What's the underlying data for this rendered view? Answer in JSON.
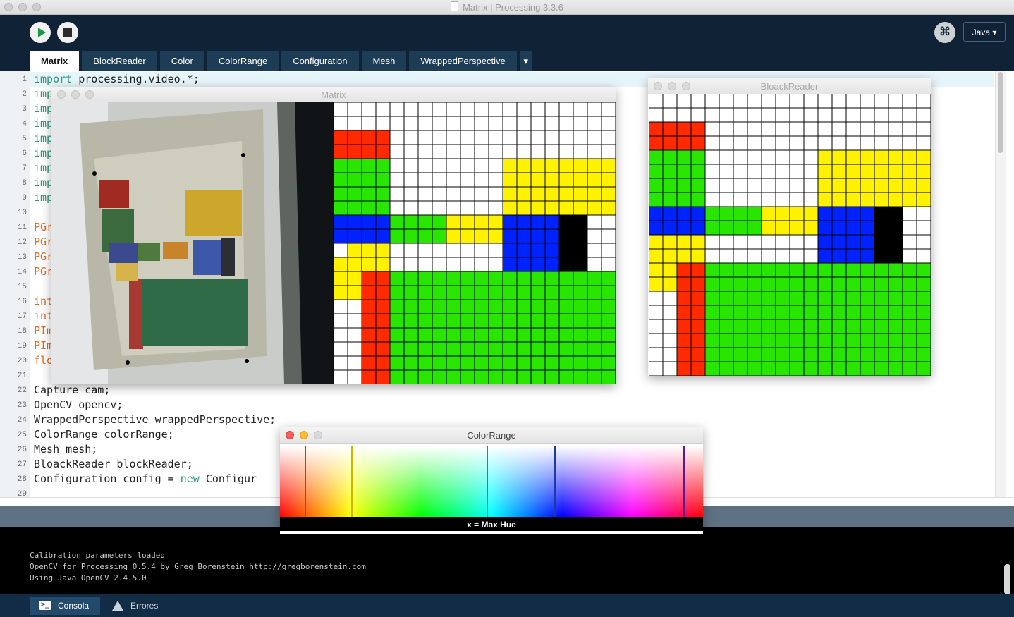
{
  "window": {
    "title": "Matrix | Processing 3.3.6"
  },
  "toolbar": {
    "run": "run-icon",
    "stop": "stop-icon",
    "mode_icon": "⌘",
    "mode_label": "Java ▾"
  },
  "tabs": [
    "Matrix",
    "BlockReader",
    "Color",
    "ColorRange",
    "Configuration",
    "Mesh",
    "WrappedPerspective",
    "▾"
  ],
  "editor": {
    "line_numbers": [
      "1",
      "2",
      "3",
      "4",
      "5",
      "6",
      "7",
      "8",
      "9",
      "10",
      "11",
      "12",
      "13",
      "14",
      "15",
      "16",
      "17",
      "18",
      "19",
      "20",
      "21",
      "22",
      "23",
      "24",
      "25",
      "26",
      "27",
      "28",
      "29"
    ],
    "lines": [
      {
        "kw": "import",
        "rest": " processing.video.*;",
        "color": "kw"
      },
      {
        "kw": "imp",
        "rest": "",
        "color": "kw"
      },
      {
        "kw": "imp",
        "rest": "",
        "color": "kw"
      },
      {
        "kw": "imp",
        "rest": "",
        "color": "kw"
      },
      {
        "kw": "imp",
        "rest": "",
        "color": "kw"
      },
      {
        "kw": "imp",
        "rest": "",
        "color": "kw"
      },
      {
        "kw": "imp",
        "rest": "",
        "color": "kw"
      },
      {
        "kw": "imp",
        "rest": "",
        "color": "kw"
      },
      {
        "kw": "imp",
        "rest": "",
        "color": "kw"
      },
      {
        "kw": "",
        "rest": "",
        "color": "kw"
      },
      {
        "kw": "PGr",
        "rest": "",
        "color": "typ"
      },
      {
        "kw": "PGr",
        "rest": "",
        "color": "typ"
      },
      {
        "kw": "PGr",
        "rest": "",
        "color": "typ"
      },
      {
        "kw": "PGr",
        "rest": "",
        "color": "typ"
      },
      {
        "kw": "",
        "rest": "",
        "color": "kw"
      },
      {
        "kw": "int",
        "rest": "",
        "color": "typ"
      },
      {
        "kw": "int",
        "rest": "",
        "color": "typ"
      },
      {
        "kw": "PIm",
        "rest": "",
        "color": "typ"
      },
      {
        "kw": "PIm",
        "rest": "",
        "color": "typ"
      },
      {
        "kw": "flo",
        "rest": "",
        "color": "typ"
      },
      {
        "kw": "",
        "rest": "",
        "color": "kw"
      },
      {
        "kw": "",
        "rest": "Capture cam;",
        "color": "kw"
      },
      {
        "kw": "",
        "rest": "OpenCV opencv;",
        "color": "kw"
      },
      {
        "kw": "",
        "rest": "WrappedPerspective wrappedPerspective;",
        "color": "kw"
      },
      {
        "kw": "",
        "rest": "ColorRange colorRange;",
        "color": "kw"
      },
      {
        "kw": "",
        "rest": "Mesh mesh;",
        "color": "kw"
      },
      {
        "kw": "",
        "rest": "BloackReader blockReader;",
        "color": "kw"
      },
      {
        "kw": "",
        "rest": "Configuration config = ",
        "color": "kw",
        "tail_kw": "new",
        "tail": " Configur"
      },
      {
        "kw": "",
        "rest": "",
        "color": "kw"
      }
    ]
  },
  "console": {
    "lines": [
      "Calibration parameters loaded",
      "OpenCV for Processing 0.5.4 by Greg Borenstein http://gregborenstein.com",
      "Using Java OpenCV 2.4.5.0"
    ]
  },
  "bottom_tabs": {
    "console": "Consola",
    "errors": "Errores"
  },
  "matrix_window": {
    "title": "Matrix",
    "grid": {
      "rows": 20,
      "cols": 20,
      "cells": [
        "WWWWWWWWWWWWWWWWWWWW",
        "WWWWWWWWWWWWWWWWWWWW",
        "RRRRWWWWWWWWWWWWWWWW",
        "RRRRWWWWWWWWWWWWWWWW",
        "GGGGWWWWWWWWYYYYYYYY",
        "GGGGWWWWWWWWYYYYYYYY",
        "GGGGWWWWWWWWYYYYYYYY",
        "GGGGWWWWWWWWYYYYYYYY",
        "BBBBGGGGYYYYBBBBKKWW",
        "BBBBGGGGYYYYBBBBKKWW",
        "WYYYWWWWWWWWBBBBKKWW",
        "YYYYWWWWWWWWBBBBKKWW",
        "YYRRGGGGGGGGGGGGGGGG",
        "YYRRGGGGGGGGGGGGGGGG",
        "WWRRGGGGGGGGGGGGGGGG",
        "WWRRGGGGGGGGGGGGGGGG",
        "WWRRGGGGGGGGGGGGGGGG",
        "WWRRGGGGGGGGGGGGGGGG",
        "WWRRGGGGGGGGGGGGGGGG",
        "WWRRGGGGGGGGGGGGGGGG"
      ]
    }
  },
  "block_window": {
    "title": "BloackReader",
    "grid": {
      "rows": 20,
      "cols": 20,
      "cells": [
        "WWWWWWWWWWWWWWWWWWWW",
        "WWWWWWWWWWWWWWWWWWWW",
        "RRRRWWWWWWWWWWWWWWWW",
        "RRRRWWWWWWWWWWWWWWWW",
        "GGGGWWWWWWWWYYYYYYYY",
        "GGGGWWWWWWWWYYYYYYYY",
        "GGGGWWWWWWWWYYYYYYYY",
        "GGGGWWWWWWWWYYYYYYYY",
        "BBBBGGGGYYYYBBBBKKWW",
        "BBBBGGGGYYYYBBBBKKWW",
        "YYYYWWWWWWWWBBBBKKWW",
        "YYYYWWWWWWWWBBBBKKWW",
        "YYRRGGGGGGGGGGGGGGGG",
        "YYRRGGGGGGGGGGGGGGGG",
        "WWRRGGGGGGGGGGGGGGGG",
        "WWRRGGGGGGGGGGGGGGGG",
        "WWRRGGGGGGGGGGGGGGGG",
        "WWRRGGGGGGGGGGGGGGGG",
        "WWRRGGGGGGGGGGGGGGGG",
        "WWRRGGGGGGGGGGGGGGGG"
      ]
    }
  },
  "colors": {
    "W": "#ffffff",
    "R": "#ff2a00",
    "G": "#28e600",
    "Y": "#fff200",
    "B": "#0022ff",
    "K": "#000000",
    "accent_run": "#1a9a47"
  },
  "color_range_window": {
    "title": "ColorRange",
    "status": "x = Max Hue",
    "hue_markers": [
      {
        "hue": 0.06,
        "color": "#c0392b"
      },
      {
        "hue": 0.17,
        "color": "#c9b800"
      },
      {
        "hue": 0.49,
        "color": "#2e9a2e"
      },
      {
        "hue": 0.65,
        "color": "#1f3aa6"
      },
      {
        "hue": 0.955,
        "color": "#5a1a8a"
      }
    ]
  }
}
